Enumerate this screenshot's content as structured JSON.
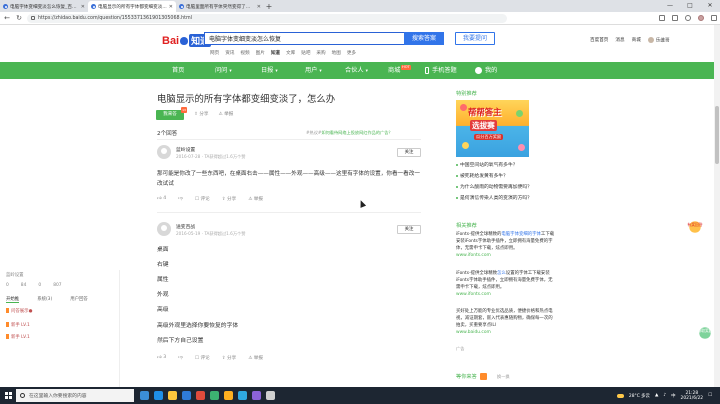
{
  "browser": {
    "tabs": [
      {
        "title": "电脑字体变细变淡怎么恢复_百度...",
        "active": false
      },
      {
        "title": "电脑显示的所有字体都变细变淡...",
        "active": true
      },
      {
        "title": "电脑里面所有字体突然变得了怎么办...",
        "active": false
      }
    ],
    "new_tab": "+",
    "url": "https://zhidao.baidu.com/question/1553371361901305068.html",
    "window_controls": [
      "—",
      "□",
      "✕"
    ]
  },
  "header": {
    "logo_text": "Bai",
    "logo_suffix": "知道",
    "search_value": "电脑字体变细变淡怎么恢复",
    "search_button": "搜索答案",
    "ask_button": "我要提问",
    "scopes": [
      "网页",
      "资讯",
      "视频",
      "图片",
      "知道",
      "文库",
      "贴吧",
      "采购",
      "地图",
      "更多"
    ],
    "scope_current": "知道",
    "top_links": [
      "百度首页",
      "消息",
      "商城"
    ],
    "username": "乐维哥"
  },
  "nav": {
    "items": [
      {
        "label": "首页",
        "caret": false
      },
      {
        "label": "问问",
        "caret": true
      },
      {
        "label": "日报",
        "caret": true
      },
      {
        "label": "用户",
        "caret": true
      },
      {
        "label": "合伙人",
        "caret": true
      },
      {
        "label": "商城",
        "caret": false,
        "badge": "HOT"
      },
      {
        "label": "手机答题",
        "caret": false
      },
      {
        "label": "我的",
        "caret": false
      }
    ]
  },
  "question": {
    "title": "电脑显示的所有字体都变细变淡了，怎么办",
    "answer_button": "我来答",
    "answer_badge": "13",
    "actions": [
      "分享",
      "举报"
    ],
    "answer_count": "2个回答",
    "promo_tag": "#热议#",
    "promo_text": "如何看待网络上投放网红作品的广告？"
  },
  "answers": [
    {
      "user": "蓝岭设置",
      "meta": "2016-07-28 · TA获得超过1.6万个赞",
      "follow": "关注",
      "text": "那可能是你改了一些东西吧，在桌面右击——属性——外观——高级——这里有字体的设置，你看一看改一改试试",
      "likes": "4",
      "dislikes": "",
      "actions": [
        "评论",
        "分享",
        "举报"
      ]
    },
    {
      "user": "送变百战",
      "meta": "2016-05-19 · TA获得超过1.6万个赞",
      "follow": "关注",
      "lines": [
        "桌面",
        "右键",
        "属性",
        "外观",
        "高级",
        "高级外观里选择你要恢复的字体",
        "然后下方自己设置"
      ],
      "likes": "3",
      "dislikes": "",
      "actions": [
        "评论",
        "分享",
        "举报"
      ]
    }
  ],
  "sidebar": {
    "special_title": "特别推荐",
    "ad_line1": "帮帮答主",
    "ad_line2": "选拔赛",
    "ad_line3": "瓜分百万奖励",
    "recommendations": [
      "中国空间站的氧气有多牛？",
      "被死耗给发黄有多牛？",
      "为什么酸雨的动物需要再加便吗？",
      "是何演信传染人类的变演的方吗？"
    ],
    "related_title": "相关推荐",
    "related": [
      {
        "pre": "iFonts-提供全球精致的",
        "hl": "电脑字体变细的字体",
        "post": "工下载安装iFonts字体助手插件，立即拥有海量免费的字体，无需申卡下载，炫点即用。",
        "src": "www.ifonts.com"
      },
      {
        "pre": "iFonts-提供全球精致",
        "hl": "怎么",
        "post": "设置的字体工下载安装iFonts字体助手插件，立即拥有海量免费字体，无需申卡下载，炫点即用。",
        "src": "www.ifonts.com"
      },
      {
        "pre": "",
        "hl": "",
        "post": "买好处上万能的专业优选品质，便捷价格和热点电视，减证期套，嵌入代表惠随购物，确保每一次的拍卖，买重要享点lLl",
        "src": "www.baidu.com"
      }
    ],
    "ad_label": "广告",
    "zhidao_title": "等你来答",
    "more": "换一换"
  },
  "float_badges": [
    "有奖回答",
    "领取奖励"
  ],
  "left_panel": {
    "title": "蓝岭设置",
    "stats": [
      "0",
      "84",
      "0",
      "807"
    ],
    "tabs": [
      "开始推",
      "系统(3)",
      "用户回答"
    ],
    "tab_current": "开始推",
    "items": [
      "问答展示●",
      "新手 LV.1",
      "新手 LV.1"
    ]
  },
  "taskbar": {
    "search_placeholder": "在这里输入你要搜索的内容",
    "weather": "28°C 多云",
    "time": "21:28",
    "date": "2021/6/22",
    "lang": "中"
  }
}
